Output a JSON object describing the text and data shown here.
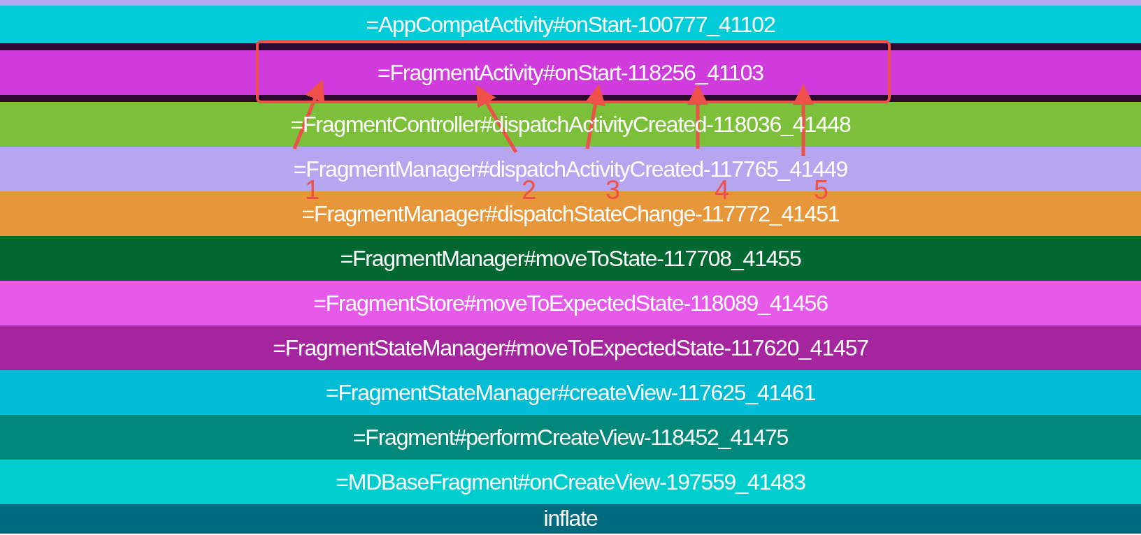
{
  "slices": [
    {
      "kind": "band",
      "color": "#b6a6f0"
    },
    {
      "kind": "slice",
      "name": "=AppCompatActivity#onStart-100777_41102",
      "color": "#00cdd8"
    },
    {
      "kind": "band",
      "color": "#2a0a2e"
    },
    {
      "kind": "slice",
      "name": "=FragmentActivity#onStart-118256_41103",
      "color": "#d03cdc"
    },
    {
      "kind": "band",
      "color": "#2a0a2e"
    },
    {
      "kind": "slice",
      "name": "=FragmentController#dispatchActivityCreated-118036_41448",
      "color": "#7cc03a"
    },
    {
      "kind": "slice",
      "name": "=FragmentManager#dispatchActivityCreated-117765_41449",
      "color": "#b6a6f0"
    },
    {
      "kind": "slice",
      "name": "=FragmentManager#dispatchStateChange-117772_41451",
      "color": "#e8963a"
    },
    {
      "kind": "slice",
      "name": "=FragmentManager#moveToState-117708_41455",
      "color": "#006830"
    },
    {
      "kind": "slice",
      "name": "=FragmentStore#moveToExpectedState-118089_41456",
      "color": "#e55ae8"
    },
    {
      "kind": "slice",
      "name": "=FragmentStateManager#moveToExpectedState-117620_41457",
      "color": "#a4259e"
    },
    {
      "kind": "slice",
      "name": "=FragmentStateManager#createView-117625_41461",
      "color": "#00bcd4"
    },
    {
      "kind": "slice",
      "name": "=Fragment#performCreateView-118452_41475",
      "color": "#00897a"
    },
    {
      "kind": "slice",
      "name": "=MDBaseFragment#onCreateView-197559_41483",
      "color": "#00cdcd"
    },
    {
      "kind": "slice",
      "name": "inflate",
      "color": "#006a7e"
    }
  ],
  "annotations": [
    {
      "label": "1"
    },
    {
      "label": "2"
    },
    {
      "label": "3"
    },
    {
      "label": "4"
    },
    {
      "label": "5"
    }
  ]
}
